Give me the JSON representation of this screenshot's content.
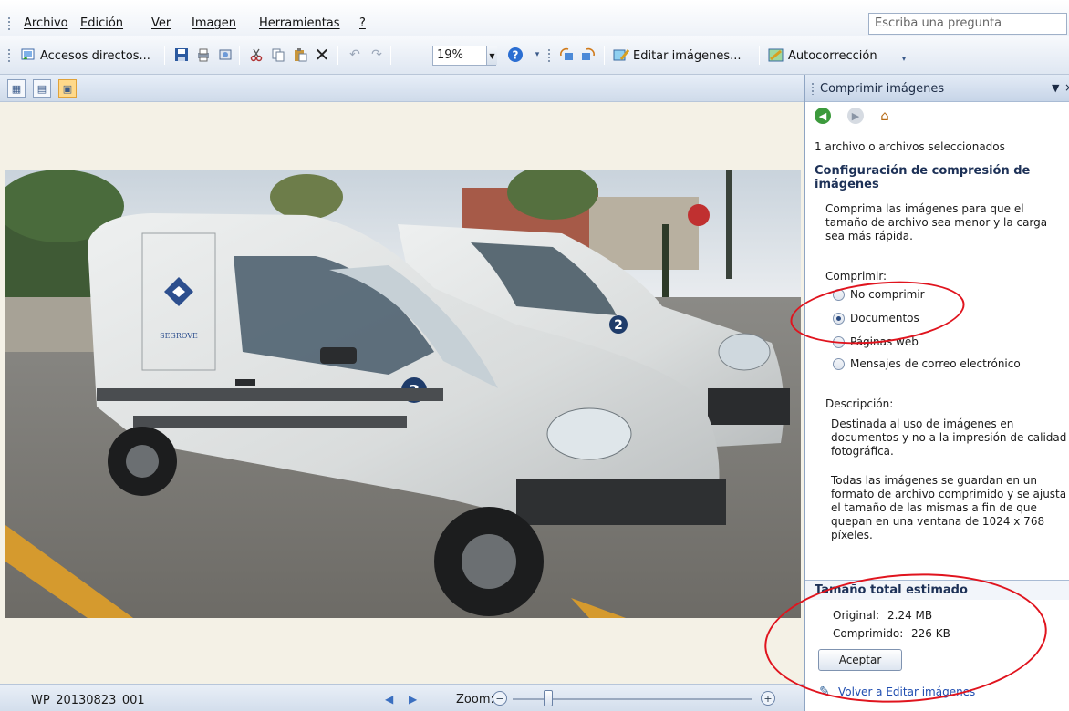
{
  "menu": {
    "items": [
      "Archivo",
      "Edición",
      "Ver",
      "Imagen",
      "Herramientas",
      "?"
    ],
    "ask_placeholder": "Escriba una pregunta"
  },
  "toolbar": {
    "shortcuts_label": "Accesos directos...",
    "zoom_value": "19%",
    "edit_images_label": "Editar imágenes...",
    "autocorrect_label": "Autocorrección"
  },
  "status": {
    "filename": "WP_20130823_001",
    "zoom_label": "Zoom:",
    "zoom_level": 0.15
  },
  "pane": {
    "title": "Comprimir imágenes",
    "selected_files": "1 archivo o archivos seleccionados",
    "config_heading": "Configuración de compresión de imágenes",
    "intro": "Comprima las imágenes para que el tamaño de archivo sea menor y la carga sea más rápida.",
    "compress_label": "Comprimir:",
    "options": [
      "No comprimir",
      "Documentos",
      "Páginas web",
      "Mensajes de correo electrónico"
    ],
    "selected_option": "Documentos",
    "description_label": "Descripción:",
    "description_1": "Destinada al uso de imágenes en documentos y no a la impresión de calidad fotográfica.",
    "description_2": "Todas las imágenes se guardan en un formato de archivo comprimido y se ajusta el tamaño de las mismas a fin de que quepan en una ventana de 1024 x 768 píxeles.",
    "estimate_heading": "Tamaño total estimado",
    "original_label": "Original:",
    "original_value": "2.24 MB",
    "compressed_label": "Comprimido:",
    "compressed_value": "226 KB",
    "accept_label": "Aceptar",
    "back_link": "Volver a Editar imágenes"
  },
  "photo": {
    "van_badge_front": "3",
    "van_badge_back": "2",
    "logo_text": "SEGROVE"
  },
  "colors": {
    "annotation": "#e0141e",
    "link": "#1f4db0"
  }
}
